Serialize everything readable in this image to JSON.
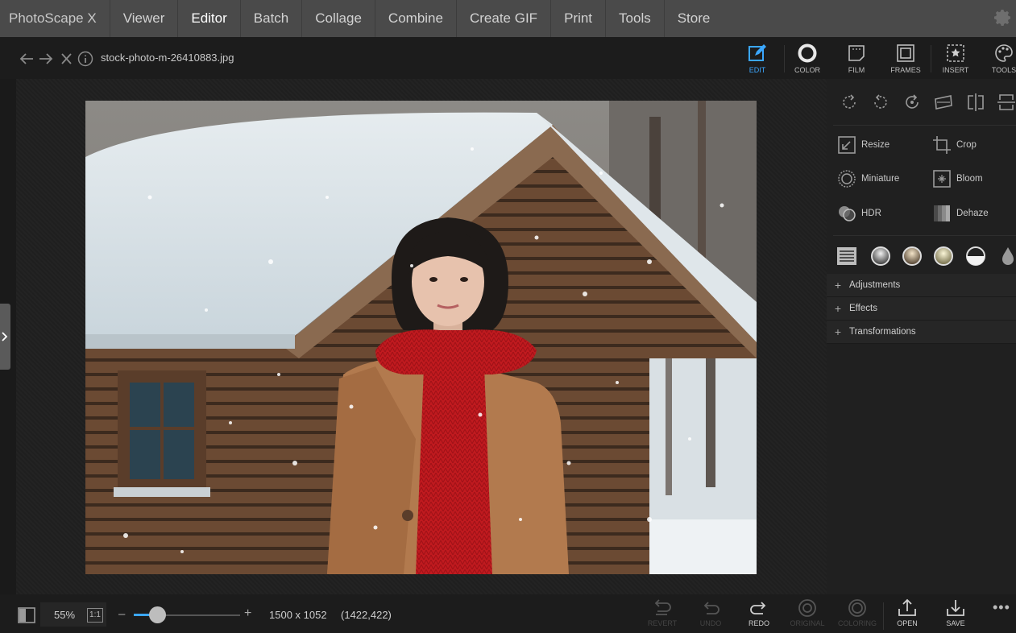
{
  "menu": {
    "app_title": "PhotoScape X",
    "items": [
      "Viewer",
      "Editor",
      "Batch",
      "Collage",
      "Combine",
      "Create GIF",
      "Print",
      "Tools",
      "Store"
    ],
    "active": "Editor"
  },
  "file": {
    "name": "stock-photo-m-26410883.jpg"
  },
  "tool_tabs": [
    {
      "label": "EDIT",
      "icon": "edit-icon",
      "active": true
    },
    {
      "label": "COLOR",
      "icon": "color-ring-icon"
    },
    {
      "label": "FILM",
      "icon": "film-icon"
    },
    {
      "label": "FRAMES",
      "icon": "frames-icon"
    },
    {
      "label": "INSERT",
      "icon": "insert-star-icon"
    },
    {
      "label": "TOOLS",
      "icon": "palette-icon"
    }
  ],
  "edit_tools": {
    "rotate_icons": [
      "rotate-right-icon",
      "rotate-left-icon",
      "rotate-free-icon",
      "straighten-icon",
      "flip-horizontal-icon",
      "flip-vertical-icon"
    ],
    "resize": "Resize",
    "crop": "Crop",
    "miniature": "Miniature",
    "bloom": "Bloom",
    "hdr": "HDR",
    "dehaze": "Dehaze"
  },
  "swatches": [
    "levels-icon",
    "tone-gray-icon",
    "tone-warm-icon",
    "tone-yellow-icon",
    "tone-half-icon",
    "drop-icon"
  ],
  "sections": [
    "Adjustments",
    "Effects",
    "Transformations"
  ],
  "status": {
    "zoom": "55%",
    "one_to_one": "1:1",
    "zoom_minus": "–",
    "zoom_plus": "+",
    "zoom_level": 0.22,
    "dimensions": "1500 x 1052",
    "cursor": "(1422,422)"
  },
  "bottom_buttons": [
    {
      "label": "REVERT",
      "enabled": false
    },
    {
      "label": "UNDO",
      "enabled": false
    },
    {
      "label": "REDO",
      "enabled": true
    },
    {
      "label": "ORIGINAL",
      "enabled": false
    },
    {
      "label": "COLORING",
      "enabled": false
    },
    {
      "label": "OPEN",
      "enabled": true
    },
    {
      "label": "SAVE",
      "enabled": true
    }
  ],
  "more_label": "•••",
  "colors": {
    "accent": "#3ba7ff",
    "scarf": "#c4191e",
    "coat": "#b27a4e",
    "cabin": "#6a4630"
  }
}
